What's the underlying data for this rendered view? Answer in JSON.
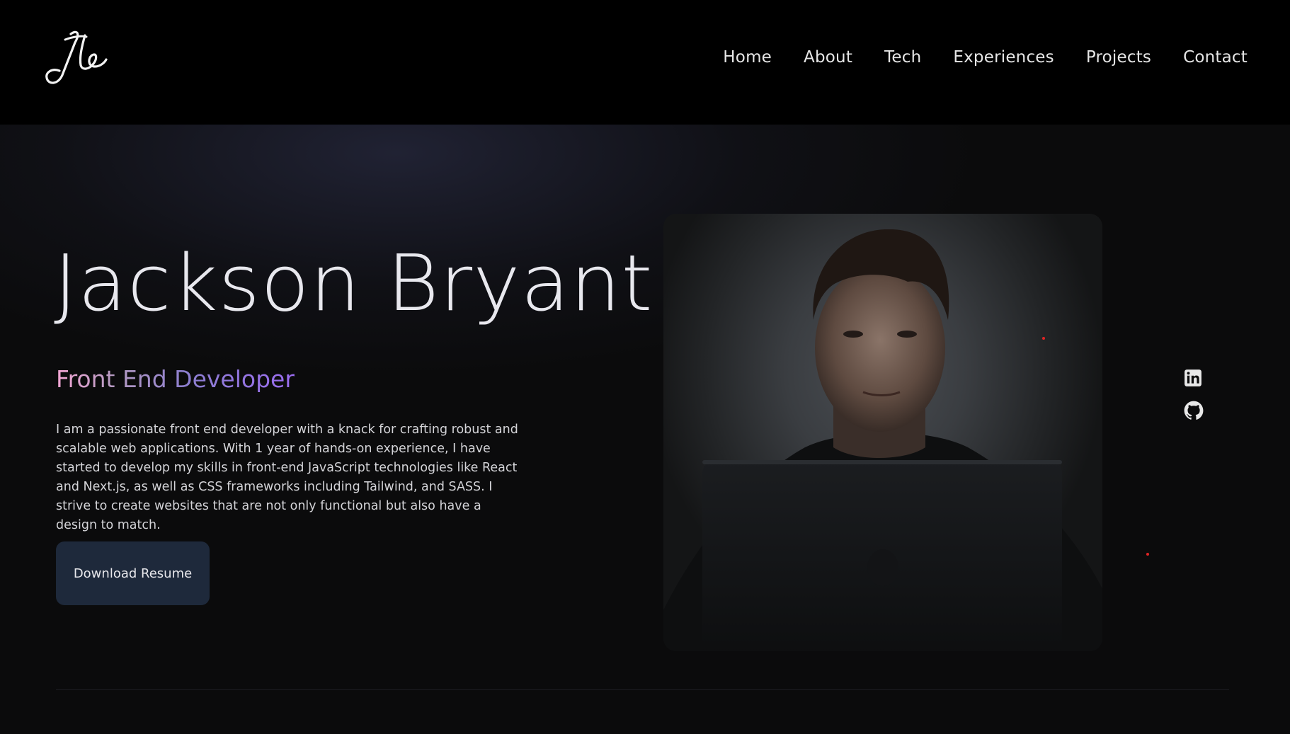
{
  "header": {
    "logo_text": "Jb",
    "nav": [
      {
        "label": "Home"
      },
      {
        "label": "About"
      },
      {
        "label": "Tech"
      },
      {
        "label": "Experiences"
      },
      {
        "label": "Projects"
      },
      {
        "label": "Contact"
      }
    ]
  },
  "hero": {
    "name": "Jackson Bryant",
    "role": "Front End Developer",
    "bio": "I am a passionate front end developer with a knack for crafting robust and scalable web applications. With 1 year of hands-on experience, I have started to develop my skills in front-end JavaScript technologies like React and Next.js, as well as CSS frameworks including Tailwind, and SASS. I strive to create websites that are not only functional but also have a design to match.",
    "resume_button": "Download Resume",
    "social": [
      {
        "icon": "linkedin-icon"
      },
      {
        "icon": "github-icon"
      }
    ]
  },
  "colors": {
    "background": "#0b0b0c",
    "header": "#000000",
    "button": "#1e293b",
    "role_gradient_start": "#f3a6d4",
    "role_gradient_end": "#9a6cf0",
    "accent_dot": "#e02424"
  }
}
